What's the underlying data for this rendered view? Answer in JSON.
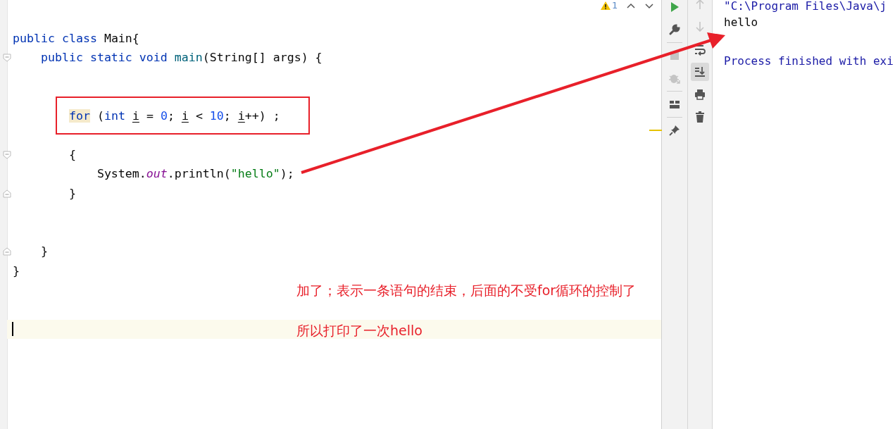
{
  "editor": {
    "inspection": {
      "count": "1"
    },
    "lines": [
      {
        "fold_start": false,
        "fold_end": false,
        "tokens": [
          {
            "kind": "keyword",
            "text": "public class"
          },
          {
            "kind": "plain",
            "text": " Main{"
          }
        ]
      },
      {
        "fold_start": true,
        "fold_end": false,
        "tokens": [
          {
            "kind": "keyword",
            "text": "    public static void"
          },
          {
            "kind": "method",
            "text": " main"
          },
          {
            "kind": "plain",
            "text": "(String[] args) {"
          }
        ]
      },
      {
        "fold_start": false,
        "fold_end": false
      },
      {
        "fold_start": false,
        "fold_end": false
      },
      {
        "fold_start": false,
        "fold_end": false,
        "boxed": true,
        "tokens": [
          {
            "kind": "keyword",
            "text": "        for",
            "highlighted": true
          },
          {
            "kind": "plain",
            "text": " ("
          },
          {
            "kind": "keyword",
            "text": "int"
          },
          {
            "kind": "var",
            "text": " i"
          },
          {
            "kind": "plain",
            "text": " = "
          },
          {
            "kind": "number",
            "text": "0"
          },
          {
            "kind": "plain",
            "text": "; "
          },
          {
            "kind": "var",
            "text": "i"
          },
          {
            "kind": "plain",
            "text": " < "
          },
          {
            "kind": "number",
            "text": "10"
          },
          {
            "kind": "plain",
            "text": "; "
          },
          {
            "kind": "var",
            "text": "i"
          },
          {
            "kind": "plain",
            "text": "++) ;"
          }
        ]
      },
      {
        "fold_start": false,
        "fold_end": false
      },
      {
        "fold_start": true,
        "fold_end": false,
        "tokens": [
          {
            "kind": "plain",
            "text": "        {"
          }
        ]
      },
      {
        "fold_start": false,
        "fold_end": false,
        "tokens": [
          {
            "kind": "plain",
            "text": "            System."
          },
          {
            "kind": "field",
            "text": "out"
          },
          {
            "kind": "plain",
            "text": ".println("
          },
          {
            "kind": "string",
            "text": "\"hello\""
          },
          {
            "kind": "plain",
            "text": ");"
          }
        ]
      },
      {
        "fold_start": false,
        "fold_end": true,
        "tokens": [
          {
            "kind": "plain",
            "text": "        }"
          }
        ]
      },
      {
        "fold_start": false,
        "fold_end": false
      },
      {
        "fold_start": false,
        "fold_end": false
      },
      {
        "fold_start": false,
        "fold_end": true,
        "tokens": [
          {
            "kind": "plain",
            "text": "    }"
          }
        ]
      },
      {
        "fold_start": false,
        "fold_end": false,
        "tokens": [
          {
            "kind": "plain",
            "text": "}"
          }
        ]
      },
      {
        "fold_start": false,
        "fold_end": false
      },
      {
        "fold_start": false,
        "fold_end": false
      },
      {
        "fold_start": false,
        "fold_end": false,
        "current": true
      }
    ],
    "notes": [
      "加了；表示一条语句的结束，后面的不受for循环的控制了",
      "所以打印了一次hello"
    ]
  },
  "toolbar_left": [
    {
      "kind": "run",
      "disabled": false
    },
    {
      "kind": "wrench",
      "disabled": false
    },
    {
      "kind": "divider"
    },
    {
      "kind": "stop",
      "disabled": true
    },
    {
      "kind": "bug",
      "disabled": true
    },
    {
      "kind": "divider"
    },
    {
      "kind": "layout",
      "disabled": false
    },
    {
      "kind": "divider"
    },
    {
      "kind": "pin",
      "disabled": false
    }
  ],
  "toolbar_right": [
    {
      "kind": "up",
      "disabled": true,
      "selected": false
    },
    {
      "kind": "down",
      "disabled": true,
      "selected": false
    },
    {
      "kind": "wrap",
      "disabled": false,
      "selected": false
    },
    {
      "kind": "scroll-end",
      "disabled": false,
      "selected": true
    },
    {
      "kind": "print",
      "disabled": false,
      "selected": false
    },
    {
      "kind": "trash",
      "disabled": false,
      "selected": false
    }
  ],
  "console": {
    "lines": [
      {
        "kind": "command",
        "text": "\"C:\\Program Files\\Java\\j"
      },
      {
        "kind": "output",
        "text": "hello"
      },
      {
        "kind": "blank"
      },
      {
        "kind": "system",
        "text": "Process finished with exi"
      }
    ]
  }
}
